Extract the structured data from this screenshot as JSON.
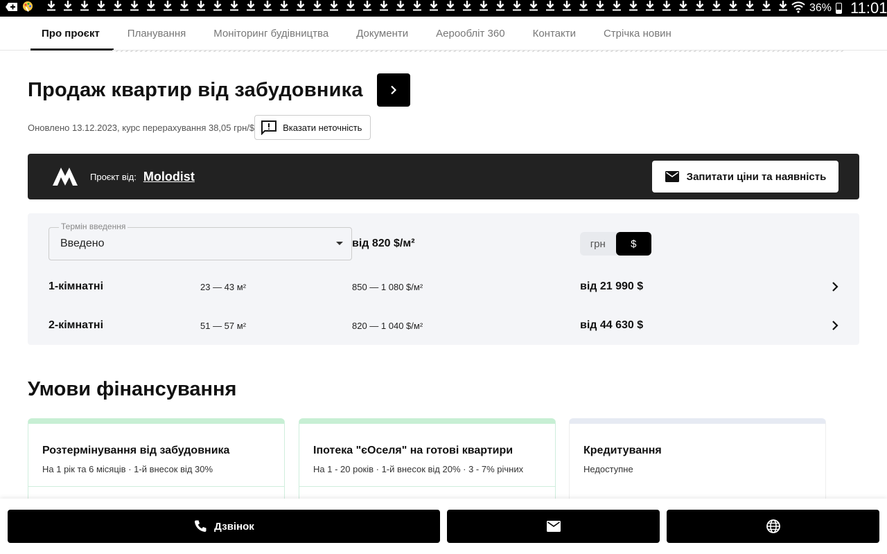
{
  "status_bar": {
    "battery": "36%",
    "time": "11:01",
    "download_count": 45
  },
  "tabs": [
    {
      "label": "Про проєкт",
      "active": true
    },
    {
      "label": "Планування",
      "active": false
    },
    {
      "label": "Моніторинг будівництва",
      "active": false
    },
    {
      "label": "Документи",
      "active": false
    },
    {
      "label": "Аерообліт 360",
      "active": false
    },
    {
      "label": "Контакти",
      "active": false
    },
    {
      "label": "Стрічка новин",
      "active": false
    }
  ],
  "header": {
    "title": "Продаж квартир від забудовника",
    "updated": "Оновлено 13.12.2023, курс перерахування 38,05 грн/$",
    "report_label": "Вказати неточність"
  },
  "developer": {
    "label": "Проєкт від:",
    "name": "Molodist",
    "ask_label": "Запитати ціни та наявність"
  },
  "prices": {
    "select_legend": "Термін введення",
    "select_value": "Введено",
    "from_price": "від 820 $/м²",
    "currency_options": [
      "грн",
      "$"
    ],
    "currency_selected": "$",
    "rows": [
      {
        "type": "1-кімнатні",
        "area": "23 — 43 м²",
        "ppm": "850 — 1 080 $/м²",
        "price": "від 21 990 $"
      },
      {
        "type": "2-кімнатні",
        "area": "51 — 57 м²",
        "ppm": "820 — 1 040 $/м²",
        "price": "від 44 630 $"
      }
    ]
  },
  "financing": {
    "title": "Умови фінансування",
    "cards": [
      {
        "title": "Розтермінування від забудовника",
        "desc": "На 1 рік та 6 місяців · 1-й внесок від 30%",
        "available": true
      },
      {
        "title": "Іпотека \"єОселя\" на готові квартири",
        "desc": "На 1 - 20 років · 1-й внесок від 20% · 3 - 7% річних",
        "available": true
      },
      {
        "title": "Кредитування",
        "desc": "Недоступне",
        "available": false
      }
    ]
  },
  "bottom_bar": {
    "call_label": "Дзвінок"
  },
  "colors": {
    "accent": "#000000",
    "dev_bar": "#222222",
    "panel_bg": "#f4f5f8",
    "card_green": "#c7efd4",
    "card_grey": "#e6eaf3"
  }
}
